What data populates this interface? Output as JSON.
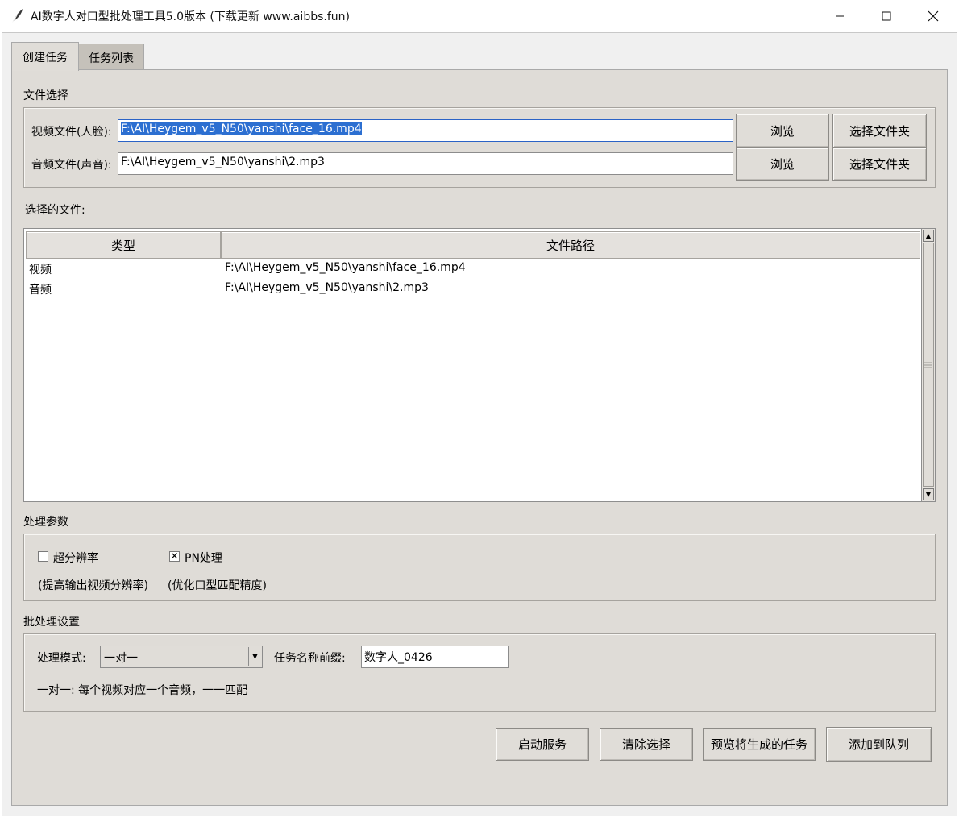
{
  "window": {
    "title": "AI数字人对口型批处理工具5.0版本 (下载更新 www.aibbs.fun)"
  },
  "tabs": [
    {
      "label": "创建任务"
    },
    {
      "label": "任务列表"
    }
  ],
  "file_selection": {
    "section_label": "文件选择",
    "video": {
      "label": "视频文件(人脸):",
      "value": "F:\\AI\\Heygem_v5_N50\\yanshi\\face_16.mp4",
      "browse": "浏览",
      "choose_folder": "选择文件夹"
    },
    "audio": {
      "label": "音频文件(声音):",
      "value": "F:\\AI\\Heygem_v5_N50\\yanshi\\2.mp3",
      "browse": "浏览",
      "choose_folder": "选择文件夹"
    }
  },
  "selected_files": {
    "section_label": "选择的文件:",
    "columns": [
      "类型",
      "文件路径"
    ],
    "rows": [
      {
        "type": "视频",
        "path": "F:\\AI\\Heygem_v5_N50\\yanshi\\face_16.mp4"
      },
      {
        "type": "音频",
        "path": "F:\\AI\\Heygem_v5_N50\\yanshi\\2.mp3"
      }
    ]
  },
  "params": {
    "section_label": "处理参数",
    "super_res": {
      "label": "超分辨率",
      "checked": false,
      "hint": "(提高输出视频分辨率)"
    },
    "pn": {
      "label": "PN处理",
      "checked": true,
      "hint": "(优化口型匹配精度)"
    }
  },
  "batch": {
    "section_label": "批处理设置",
    "mode_label": "处理模式:",
    "mode_value": "一对一",
    "prefix_label": "任务名称前缀:",
    "prefix_value": "数字人_0426",
    "mode_desc": "一对一: 每个视频对应一个音频，一一匹配"
  },
  "actions": {
    "start_service": "启动服务",
    "clear_selection": "清除选择",
    "preview_tasks": "预览将生成的任务",
    "add_to_queue": "添加到队列"
  },
  "icons": {
    "app": "feather-icon",
    "minimize": "minimize-icon",
    "maximize": "maximize-icon",
    "close": "close-icon"
  }
}
